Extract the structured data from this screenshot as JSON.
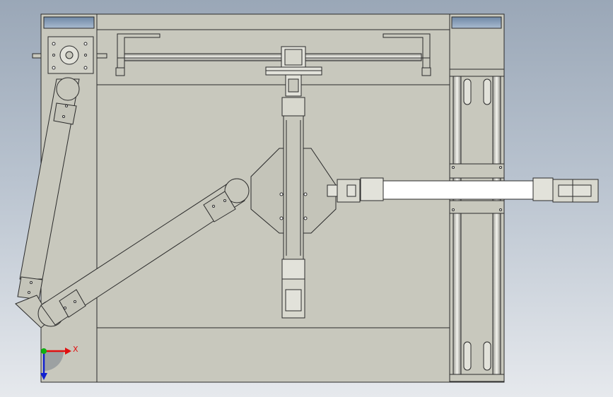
{
  "viewport": {
    "background": "#aeb8c5",
    "part_fill": "#c8c8bd",
    "part_fill_light": "#e2e2da",
    "edge_color": "#2a2a2a"
  },
  "triad": {
    "x_label": "X",
    "x_color": "#e01010",
    "y_color": "#10b010",
    "z_color": "#1020d0"
  }
}
